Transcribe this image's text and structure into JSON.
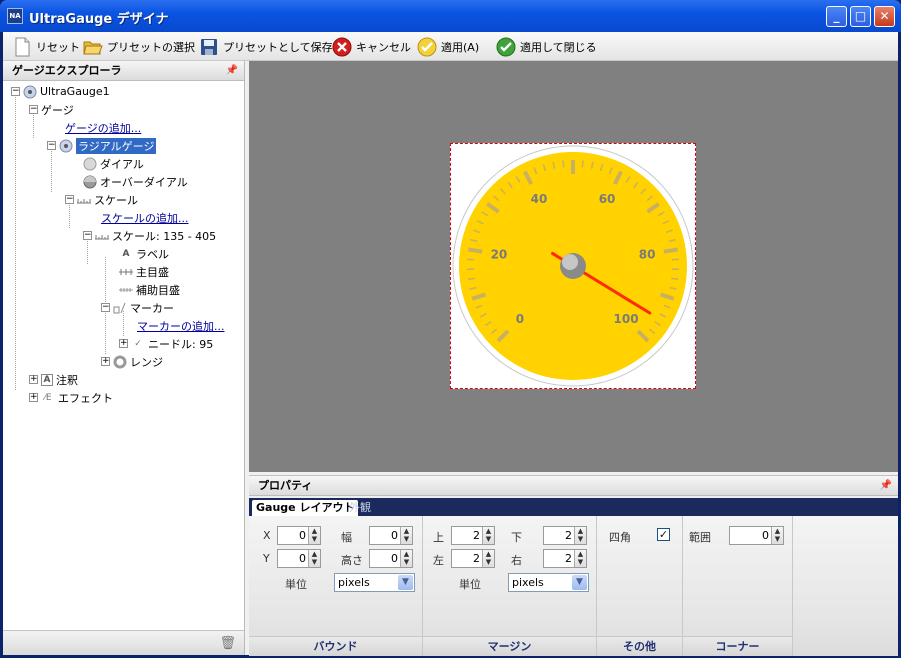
{
  "window": {
    "title": "UltraGauge デザイナ",
    "app_icon": "NA"
  },
  "toolbar": {
    "reset": "リセット",
    "select_preset": "プリセットの選択",
    "save_preset": "プリセットとして保存",
    "cancel": "キャンセル",
    "apply": "適用(A)",
    "apply_close": "適用して閉じる"
  },
  "explorer": {
    "title": "ゲージエクスプローラ",
    "nodes": {
      "root": "UltraGauge1",
      "gauges": "ゲージ",
      "add_gauge": "ゲージの追加...",
      "radial": "ラジアルゲージ",
      "dial": "ダイアル",
      "overdial": "オーバーダイアル",
      "scales": "スケール",
      "add_scale": "スケールの追加...",
      "scale1": "スケール: 135 - 405",
      "label": "ラベル",
      "major": "主目盛",
      "minor": "補助目盛",
      "markers": "マーカー",
      "add_marker": "マーカーの追加...",
      "needle": "ニードル: 95",
      "range": "レンジ",
      "annotations": "注釈",
      "effects": "エフェクト"
    }
  },
  "gauge": {
    "labels": [
      "0",
      "20",
      "40",
      "60",
      "80",
      "100"
    ],
    "needle_value": 95,
    "dial_color": "#ffd200",
    "needle_color": "#ff2a00"
  },
  "properties": {
    "title": "プロパティ",
    "tabs": {
      "layout": "Gauge レイアウト",
      "appearance": "外観"
    },
    "bounds": {
      "name": "バウンド",
      "x_label": "X",
      "x": "0",
      "y_label": "Y",
      "y": "0",
      "w_label": "幅",
      "w": "0",
      "h_label": "高さ",
      "h": "0",
      "unit_label": "単位",
      "unit": "pixels"
    },
    "margin": {
      "name": "マージン",
      "top_label": "上",
      "top": "2",
      "bottom_label": "下",
      "bottom": "2",
      "left_label": "左",
      "left": "2",
      "right_label": "右",
      "right": "2",
      "unit_label": "単位",
      "unit": "pixels"
    },
    "other": {
      "name": "その他",
      "square_label": "四角",
      "square_checked": "✓"
    },
    "corner": {
      "name": "コーナー",
      "range_label": "範囲",
      "range": "0"
    }
  }
}
